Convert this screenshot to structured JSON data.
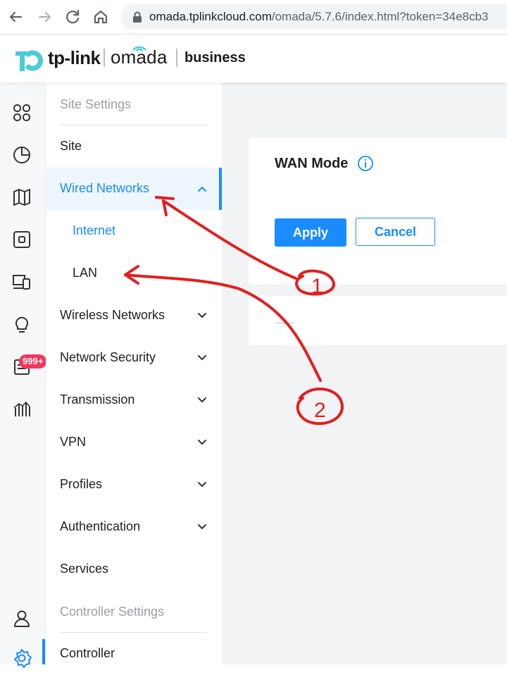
{
  "browser": {
    "url_host": "omada.tplinkcloud.com",
    "url_path": "/omada/5.7.6/index.html?token=34e8cb3",
    "icons": [
      "back-icon",
      "forward-icon",
      "reload-icon",
      "home-icon",
      "lock-icon"
    ]
  },
  "header": {
    "brand": "tp-link",
    "product": "omada",
    "edition": "business"
  },
  "rail": {
    "items": [
      "dashboard-icon",
      "statistics-icon",
      "map-icon",
      "devices-icon",
      "clients-icon",
      "insight-icon",
      "logs-icon",
      "reports-icon",
      "account-icon",
      "settings-icon"
    ],
    "badge": "999+"
  },
  "menu": {
    "section_site": "Site Settings",
    "items": [
      {
        "label": "Site"
      },
      {
        "label": "Wired Networks",
        "expanded": true
      },
      {
        "label": "Internet"
      },
      {
        "label": "LAN"
      },
      {
        "label": "Wireless Networks"
      },
      {
        "label": "Network Security"
      },
      {
        "label": "Transmission"
      },
      {
        "label": "VPN"
      },
      {
        "label": "Profiles"
      },
      {
        "label": "Authentication"
      },
      {
        "label": "Services"
      }
    ],
    "section_controller": "Controller Settings",
    "controller_item": "Controller"
  },
  "main": {
    "wan_mode_title": "WAN Mode",
    "apply_label": "Apply",
    "cancel_label": "Cancel"
  },
  "annotations": {
    "marker1": "1",
    "marker2": "2",
    "color": "#e02020"
  },
  "colors": {
    "accent": "#1a8cff",
    "logo": "#4acbd6",
    "badge": "#f5365c"
  }
}
